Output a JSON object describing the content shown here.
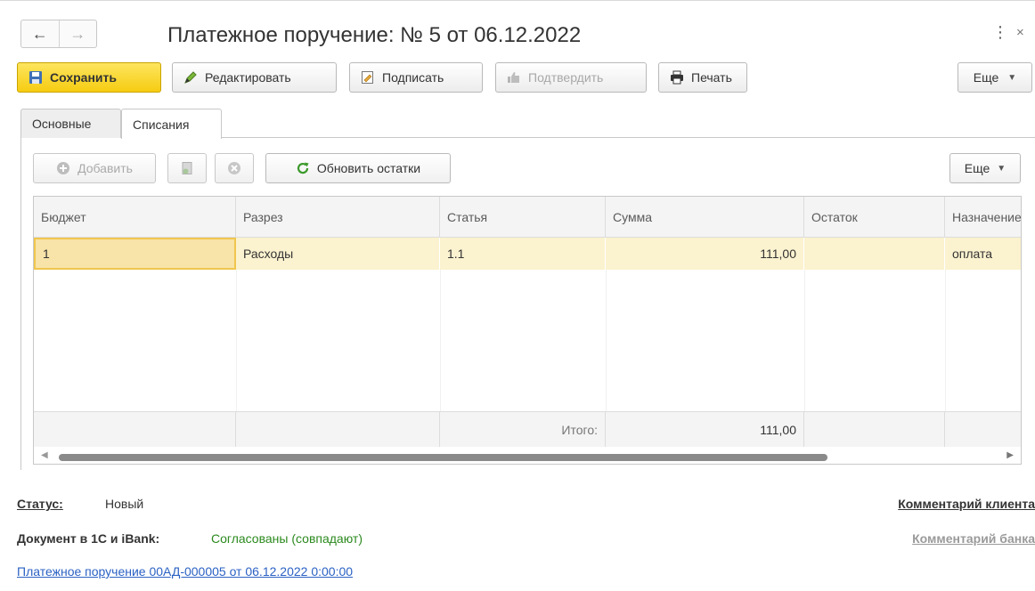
{
  "window": {
    "title": "Платежное поручение: № 5 от 06.12.2022",
    "back_glyph": "←",
    "forward_glyph": "→",
    "menu_glyph": "⋮",
    "close_glyph": "×"
  },
  "toolbar": {
    "save_label": "Сохранить",
    "edit_label": "Редактировать",
    "sign_label": "Подписать",
    "confirm_label": "Подтвердить",
    "print_label": "Печать",
    "more_label": "Еще"
  },
  "tabs": [
    {
      "label": "Основные",
      "active": false
    },
    {
      "label": "Списания",
      "active": true
    }
  ],
  "writeoffs": {
    "add_label": "Добавить",
    "refresh_label": "Обновить остатки",
    "more_label": "Еще",
    "columns": [
      "Бюджет",
      "Разрез",
      "Статья",
      "Сумма",
      "Остаток",
      "Назначение"
    ],
    "rows": [
      {
        "budget": "1",
        "section": "Расходы",
        "article": "1.1",
        "amount": "111,00",
        "balance": "",
        "purpose": "оплата"
      }
    ],
    "totals": {
      "label": "Итого:",
      "amount": "111,00"
    }
  },
  "status": {
    "label": "Статус:",
    "value": "Новый"
  },
  "sync": {
    "label": "Документ в 1С и iBank:",
    "value": "Согласованы (совпадают)"
  },
  "links": {
    "payment_order": "Платежное поручение 00АД-000005 от 06.12.2022 0:00:00",
    "client_comment": "Комментарий клиента",
    "bank_comment": "Комментарий банка"
  },
  "colors": {
    "accent_yellow": "#f6cc12",
    "selected_row": "#fbf2cf",
    "link_blue": "#2b62c4",
    "ok_green": "#2b8a1e"
  }
}
